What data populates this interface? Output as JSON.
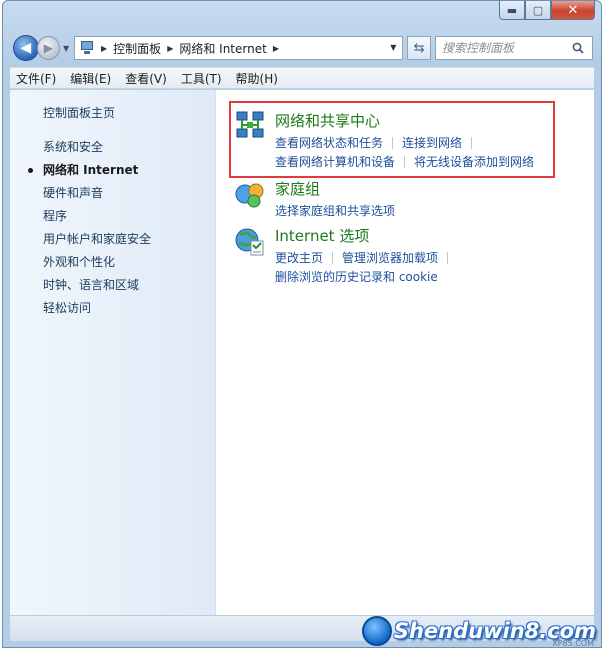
{
  "window": {
    "caption": {
      "minimize": "▬",
      "maximize": "▢",
      "close": "✕"
    }
  },
  "nav": {
    "breadcrumbs": [
      "控制面板",
      "网络和 Internet"
    ],
    "search_placeholder": "搜索控制面板"
  },
  "menu": {
    "items": [
      "文件(F)",
      "编辑(E)",
      "查看(V)",
      "工具(T)",
      "帮助(H)"
    ]
  },
  "leftpane": {
    "home": "控制面板主页",
    "items": [
      {
        "label": "系统和安全",
        "active": false
      },
      {
        "label": "网络和 Internet",
        "active": true
      },
      {
        "label": "硬件和声音",
        "active": false
      },
      {
        "label": "程序",
        "active": false
      },
      {
        "label": "用户帐户和家庭安全",
        "active": false
      },
      {
        "label": "外观和个性化",
        "active": false
      },
      {
        "label": "时钟、语言和区域",
        "active": false
      },
      {
        "label": "轻松访问",
        "active": false
      }
    ]
  },
  "categories": {
    "network_center": {
      "title": "网络和共享中心",
      "links": [
        "查看网络状态和任务",
        "连接到网络",
        "查看网络计算机和设备",
        "将无线设备添加到网络"
      ]
    },
    "homegroup": {
      "title": "家庭组",
      "links": [
        "选择家庭组和共享选项"
      ]
    },
    "internet_options": {
      "title": "Internet 选项",
      "links": [
        "更改主页",
        "管理浏览器加载项",
        "删除浏览的历史记录和 cookie"
      ]
    }
  },
  "watermark": {
    "text": "Shenduwin8.com",
    "sub": "XP85.COM"
  },
  "colors": {
    "link": "#1c4f9c",
    "category_title": "#1a7a1a",
    "highlight_border": "#e03a3a",
    "left_pane": "#e8f0f9"
  }
}
